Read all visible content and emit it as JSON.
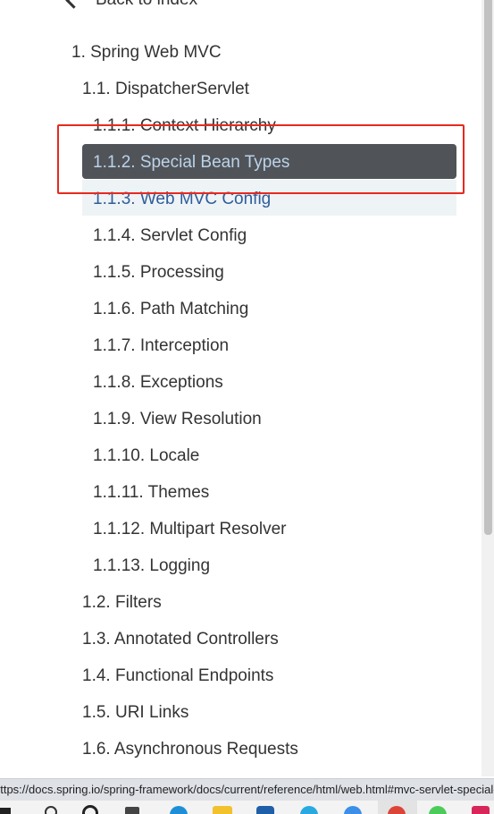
{
  "nav": {
    "back_label": "Back to index"
  },
  "toc": {
    "items": [
      {
        "label": "1. Spring Web MVC"
      },
      {
        "label": "1.1. DispatcherServlet"
      },
      {
        "label": "1.1.1. Context Hierarchy"
      },
      {
        "label": "1.1.2. Special Bean Types"
      },
      {
        "label": "1.1.3. Web MVC Config"
      },
      {
        "label": "1.1.4. Servlet Config"
      },
      {
        "label": "1.1.5. Processing"
      },
      {
        "label": "1.1.6. Path Matching"
      },
      {
        "label": "1.1.7. Interception"
      },
      {
        "label": "1.1.8. Exceptions"
      },
      {
        "label": "1.1.9. View Resolution"
      },
      {
        "label": "1.1.10. Locale"
      },
      {
        "label": "1.1.11. Themes"
      },
      {
        "label": "1.1.12. Multipart Resolver"
      },
      {
        "label": "1.1.13. Logging"
      },
      {
        "label": "1.2. Filters"
      },
      {
        "label": "1.3. Annotated Controllers"
      },
      {
        "label": "1.4. Functional Endpoints"
      },
      {
        "label": "1.5. URI Links"
      },
      {
        "label": "1.6. Asynchronous Requests"
      }
    ]
  },
  "status": {
    "url": "https://docs.spring.io/spring-framework/docs/current/reference/html/web.html#mvc-servlet-special-bean-types"
  },
  "colors": {
    "active_bg": "#505458",
    "active_text": "#bcd2ea",
    "highlight_box": "#e8291f",
    "link_text": "#2e5d9a"
  }
}
